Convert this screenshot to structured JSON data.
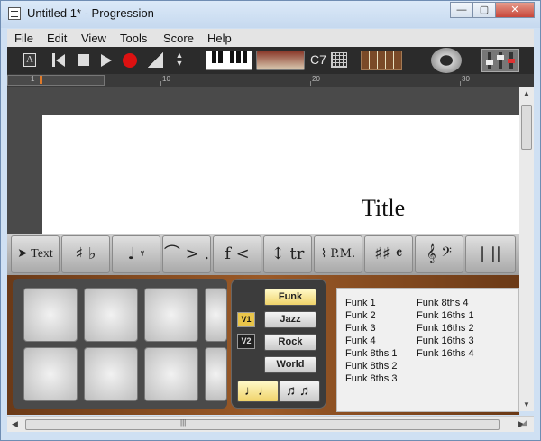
{
  "window": {
    "title": "Untitled 1* - Progression",
    "min": "—",
    "max": "▢",
    "close": "✕"
  },
  "menu": [
    "File",
    "Edit",
    "View",
    "Tools",
    "Score",
    "Help"
  ],
  "toolbar": {
    "text_icon": "A",
    "chord": "C7"
  },
  "ruler": {
    "marks": [
      "1",
      "10",
      "20",
      "30"
    ]
  },
  "score": {
    "title": "Title"
  },
  "palette": [
    {
      "name": "text",
      "label": "Text"
    },
    {
      "name": "accidentals",
      "label": "♯ ♭"
    },
    {
      "name": "note-rest",
      "label": "♩ 𝄾"
    },
    {
      "name": "articulations",
      "label": "⌒ > ."
    },
    {
      "name": "dynamics",
      "label": "f <"
    },
    {
      "name": "ornaments",
      "label": "↕ tr"
    },
    {
      "name": "techniques",
      "label": "⌇ P.M."
    },
    {
      "name": "key-signature",
      "label": "♯♯ 𝄴"
    },
    {
      "name": "clef",
      "label": "𝄞 𝄢"
    },
    {
      "name": "barline",
      "label": "| ||"
    }
  ],
  "drum": {
    "styles": [
      {
        "label": "Funk",
        "active": true
      },
      {
        "label": "Jazz",
        "active": false
      },
      {
        "label": "Rock",
        "active": false
      },
      {
        "label": "World",
        "active": false
      }
    ],
    "voices": [
      {
        "label": "V1",
        "active": true
      },
      {
        "label": "V2",
        "active": false
      }
    ],
    "note_buttons": [
      "♩♩",
      "♬♬"
    ],
    "patterns_left": [
      "Funk 1",
      "Funk 2",
      "Funk 3",
      "Funk 4",
      "Funk 8ths 1",
      "Funk 8ths 2",
      "Funk 8ths 3"
    ],
    "patterns_right": [
      "Funk 8ths 4",
      "Funk 16ths 1",
      "Funk 16ths 2",
      "Funk 16ths 3",
      "Funk 16ths 4"
    ]
  },
  "colors": {
    "toolbar": "#2b2b2b",
    "accent_orange": "#e07a2a",
    "active_style": "#f0d36a",
    "wood": "#9b5a28"
  }
}
